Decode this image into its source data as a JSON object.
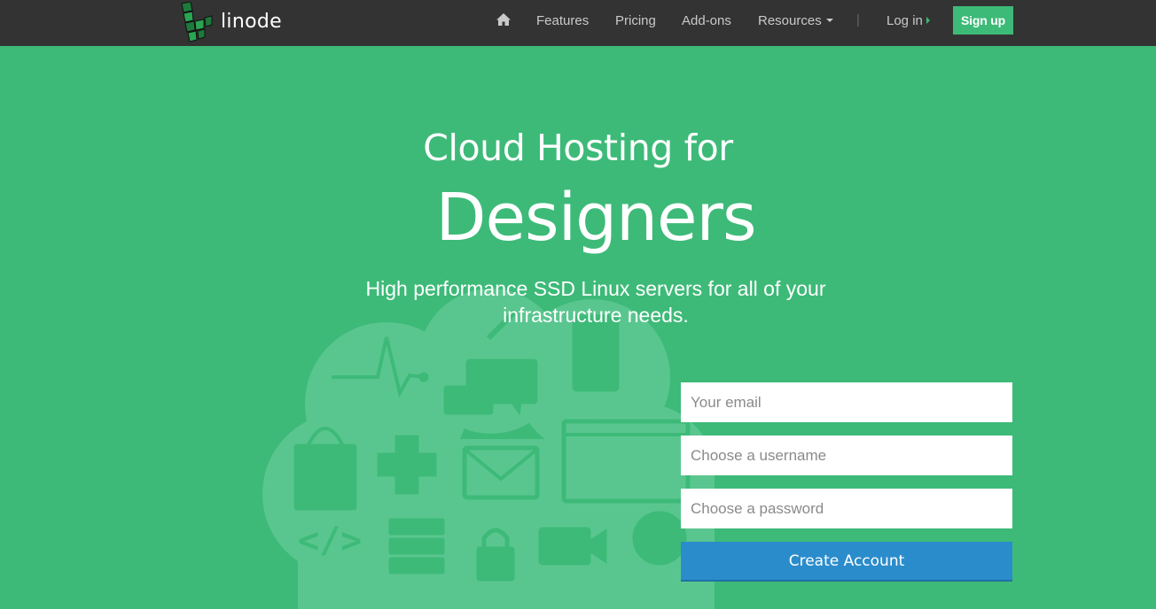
{
  "brand": {
    "name": "linode",
    "accent": "#3dba78",
    "dark": "#333333",
    "button_blue": "#2b8ccc"
  },
  "nav": {
    "home_icon": "home-icon",
    "items": [
      {
        "label": "Features"
      },
      {
        "label": "Pricing"
      },
      {
        "label": "Add-ons"
      },
      {
        "label": "Resources"
      }
    ],
    "separator": "|",
    "login": "Log in",
    "signup": "Sign up"
  },
  "hero": {
    "line1": "Cloud Hosting for",
    "line2": "Designers",
    "subtitle": "High performance SSD Linux servers for all of your infrastructure needs."
  },
  "form": {
    "email_placeholder": "Your email",
    "username_placeholder": "Choose a username",
    "password_placeholder": "Choose a password",
    "submit": "Create Account"
  }
}
